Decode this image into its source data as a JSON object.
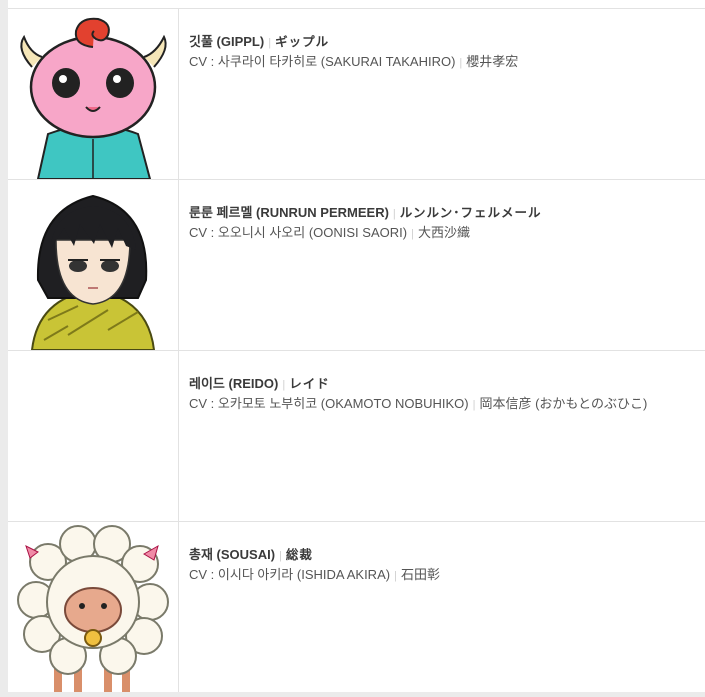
{
  "characters": [
    {
      "name_ko": "깃풀 (GIPPL)",
      "name_ja": "ギップル",
      "cv_line": "CV : 사쿠라이 타카히로 (SAKURAI TAKAHIRO)",
      "cv_ja": "櫻井孝宏",
      "portrait": "gippl-portrait"
    },
    {
      "name_ko": "룬룬 페르멜 (RUNRUN PERMEER)",
      "name_ja": "ルンルン･フェルメール",
      "cv_line": "CV : 오오니시 사오리 (OONISI SAORI)",
      "cv_ja": "大西沙織",
      "portrait": "runrun-portrait"
    },
    {
      "name_ko": "레이드 (REIDO)",
      "name_ja": "レイド",
      "cv_line": "CV : 오카모토 노부히코 (OKAMOTO NOBUHIKO)",
      "cv_ja": "岡本信彦 (おかもとのぶひこ)",
      "portrait": ""
    },
    {
      "name_ko": "총재 (SOUSAI)",
      "name_ja": "総裁",
      "cv_line": "CV : 이시다 아키라 (ISHIDA AKIRA)",
      "cv_ja": "石田彰",
      "portrait": "sousai-portrait"
    }
  ],
  "separator": "|"
}
